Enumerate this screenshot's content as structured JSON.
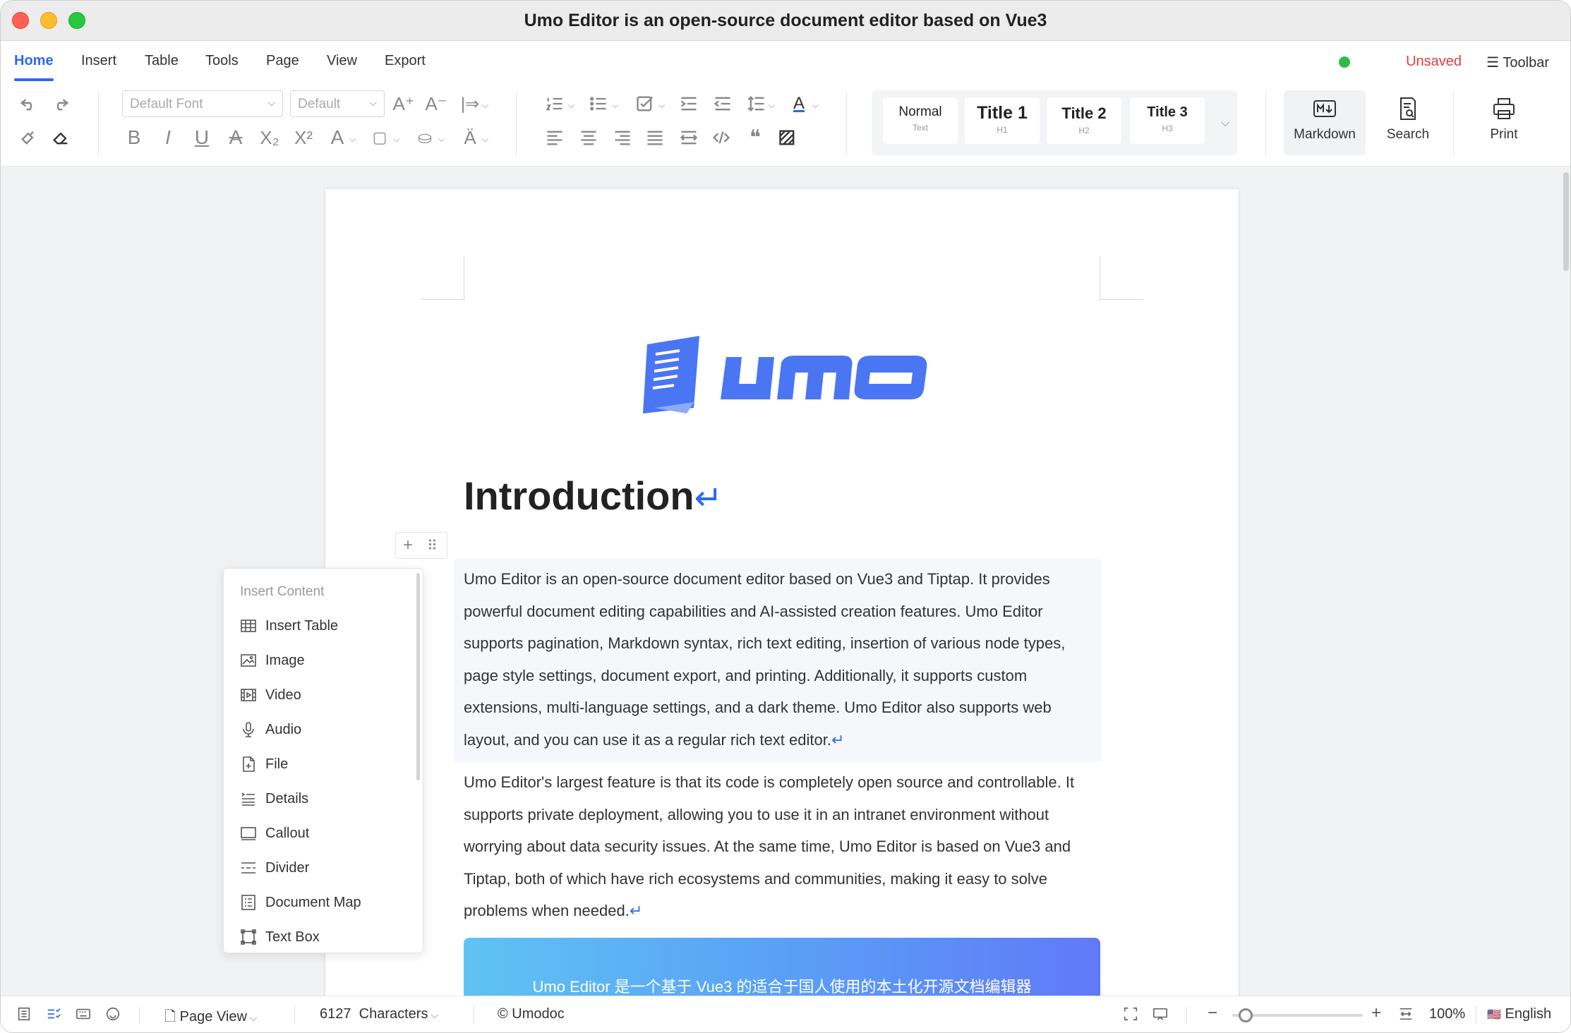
{
  "window": {
    "title": "Umo Editor is an open-source document editor based on Vue3"
  },
  "menu": {
    "tabs": [
      "Home",
      "Insert",
      "Table",
      "Tools",
      "Page",
      "View",
      "Export"
    ],
    "active": "Home",
    "save_status": "Unsaved",
    "toolbar_toggle": "Toolbar"
  },
  "ribbon": {
    "font_family": "Default Font",
    "font_size": "Default",
    "styles": [
      {
        "label": "Normal",
        "sub": "Text"
      },
      {
        "label": "Title 1",
        "sub": "H1"
      },
      {
        "label": "Title 2",
        "sub": "H2"
      },
      {
        "label": "Title 3",
        "sub": "H3"
      }
    ],
    "markdown_label": "Markdown",
    "search_label": "Search",
    "print_label": "Print",
    "accent_color": "#2c68f6"
  },
  "document": {
    "heading": "Introduction",
    "return_mark": "↵",
    "paragraph1": "Umo Editor is an open-source document editor based on Vue3 and Tiptap. It provides powerful document editing capabilities and AI-assisted creation features. Umo Editor supports pagination, Markdown syntax, rich text editing, insertion of various node types, page style settings, document export, and printing. Additionally, it supports custom extensions, multi-language settings, and a dark theme. Umo Editor also supports web layout, and you can use it as a regular rich text editor.",
    "paragraph2": "Umo Editor's largest feature is that its code is completely open source and controllable. It supports private deployment, allowing you to use it in an intranet environment without worrying about data security issues. At the same time, Umo Editor is based on Vue3 and Tiptap, both of which have rich ecosystems and communities, making it easy to solve problems when needed.",
    "banner_text": "Umo Editor 是一个基于 Vue3 的适合于国人使用的本土化开源文档编辑器"
  },
  "insert_menu": {
    "header": "Insert Content",
    "items": [
      {
        "label": "Insert Table",
        "icon": "table-icon"
      },
      {
        "label": "Image",
        "icon": "image-icon"
      },
      {
        "label": "Video",
        "icon": "video-icon"
      },
      {
        "label": "Audio",
        "icon": "microphone-icon"
      },
      {
        "label": "File",
        "icon": "file-icon"
      },
      {
        "label": "Details",
        "icon": "details-icon"
      },
      {
        "label": "Callout",
        "icon": "callout-icon"
      },
      {
        "label": "Divider",
        "icon": "divider-icon"
      },
      {
        "label": "Document Map",
        "icon": "document-map-icon"
      },
      {
        "label": "Text Box",
        "icon": "text-box-icon"
      }
    ]
  },
  "statusbar": {
    "view_mode": "Page View",
    "char_count": "6127",
    "char_label": "Characters",
    "brand": "Umodoc",
    "zoom": "100%",
    "zoom_fraction": 0.1,
    "language": "English",
    "language_flag": "🇺🇸"
  }
}
